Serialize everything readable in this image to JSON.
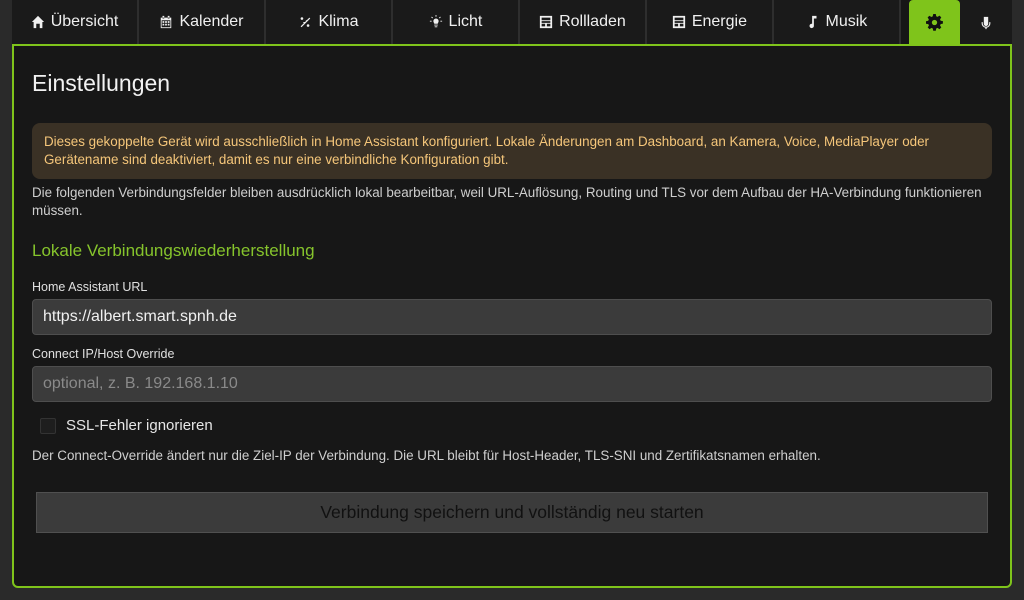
{
  "tabs": [
    {
      "label": "Übersicht",
      "icon": "home-icon"
    },
    {
      "label": "Kalender",
      "icon": "calendar-icon"
    },
    {
      "label": "Klima",
      "icon": "climate-icon"
    },
    {
      "label": "Licht",
      "icon": "light-icon"
    },
    {
      "label": "Rollladen",
      "icon": "blinds-icon"
    },
    {
      "label": "Energie",
      "icon": "energy-icon"
    },
    {
      "label": "Musik",
      "icon": "music-note-icon"
    },
    {
      "label": "",
      "icon": "gear-icon",
      "active": true
    },
    {
      "label": "",
      "icon": "microphone-icon"
    }
  ],
  "colors": {
    "accent": "#7fc41b",
    "warning_text": "#f5c67a",
    "warning_bg": "#3a3125",
    "section": "#86c42c"
  },
  "page": {
    "title": "Einstellungen",
    "warning": "Dieses gekoppelte Gerät wird ausschließlich in Home Assistant konfiguriert. Lokale Änderungen am Dashboard, an Kamera, Voice, MediaPlayer oder Gerätename sind deaktiviert, damit es nur eine verbindliche Konfiguration gibt.",
    "info": "Die folgenden Verbindungsfelder bleiben ausdrücklich lokal bearbeitbar, weil URL-Auflösung, Routing und TLS vor dem Aufbau der HA-Verbindung funktionieren müssen.",
    "section_title": "Lokale Verbindungswiederherstellung",
    "url_label": "Home Assistant URL",
    "url_value": "https://albert.smart.spnh.de",
    "override_label": "Connect IP/Host Override",
    "override_placeholder": "optional, z. B. 192.168.1.10",
    "ssl_label": "SSL-Fehler ignorieren",
    "ssl_checked": false,
    "note": "Der Connect-Override ändert nur die Ziel-IP der Verbindung. Die URL bleibt für Host-Header, TLS-SNI und Zertifikatsnamen erhalten.",
    "save_button": "Verbindung speichern und vollständig neu starten"
  }
}
